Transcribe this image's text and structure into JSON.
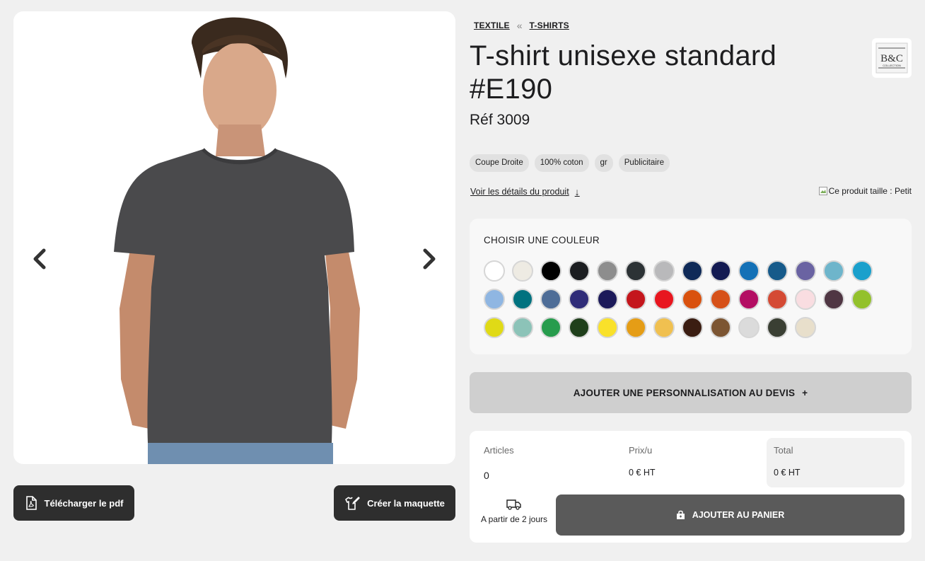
{
  "breadcrumb": {
    "items": [
      "TEXTILE",
      "T-SHIRTS"
    ],
    "separator": "«"
  },
  "product": {
    "title": "T-shirt unisexe standard #E190",
    "ref": "Réf 3009",
    "brand_logo_text": "B&C",
    "brand_logo_subtext": "COLLECTION",
    "tags": [
      "Coupe Droite",
      "100% coton",
      "gr",
      "Publicitaire"
    ],
    "details_link": "Voir les détails du produit",
    "details_arrow": "↓",
    "size_note": "Ce produit taille : Petit"
  },
  "gallery": {
    "prev_arrow": "prev-chevron",
    "next_arrow": "next-chevron",
    "shirt_color": "#4a4a4c"
  },
  "actions": {
    "pdf_label": "Télécharger le pdf",
    "maquette_label": "Créer la maquette"
  },
  "colors": {
    "heading": "CHOISIR UNE COULEUR",
    "swatches": [
      "#ffffff",
      "#eeebe3",
      "#000000",
      "#1b1d20",
      "#8d8d8d",
      "#2c3235",
      "#b9b9bb",
      "#0f2a58",
      "#131a52",
      "#1370b6",
      "#165a8a",
      "#6a63a2",
      "#6eb5cb",
      "#1aa0cc",
      "#8fb6e2",
      "#00727f",
      "#4e6d97",
      "#2f2c78",
      "#1c1a5a",
      "#c4161c",
      "#e8161f",
      "#d9510e",
      "#d65119",
      "#b30d63",
      "#d44a34",
      "#f9dde1",
      "#4f3643",
      "#93c12c",
      "#e0da16",
      "#8cc3b8",
      "#279c4d",
      "#1f3f1b",
      "#f9e12a",
      "#e59d16",
      "#f0c050",
      "#3b1d12",
      "#7c5532",
      "#dbdbdb",
      "#3a3f33",
      "#e8dfcb"
    ]
  },
  "personalisation": {
    "label": "AJOUTER UNE PERSONNALISATION AU DEVIS",
    "plus": "+"
  },
  "order": {
    "articles_label": "Articles",
    "articles_value": "0",
    "unit_price_label": "Prix/u",
    "unit_price_value": "0 € HT",
    "total_label": "Total",
    "total_value": "0 € HT",
    "delivery_text": "A partir de 2 jours",
    "cart_label": "AJOUTER AU PANIER"
  }
}
